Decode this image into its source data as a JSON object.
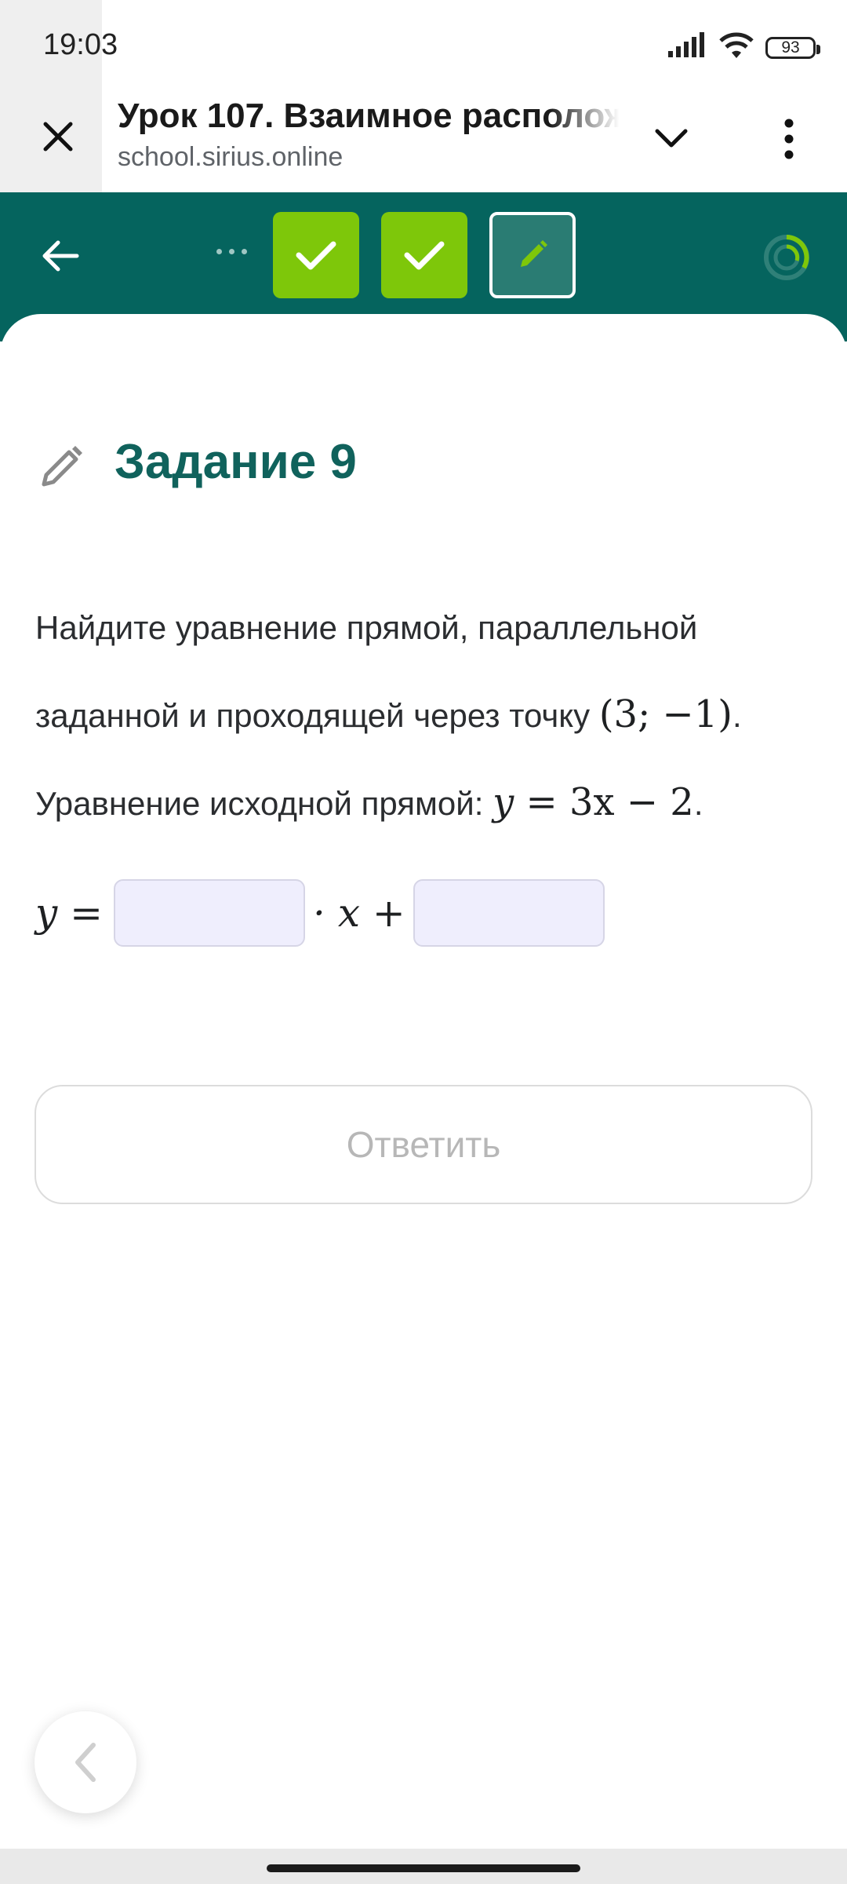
{
  "status_bar": {
    "time": "19:03",
    "battery": "93",
    "icons": [
      "signal-icon",
      "wifi-icon",
      "battery-icon"
    ]
  },
  "browser": {
    "title": "Урок 107. Взаимное располож",
    "url": "school.sirius.online",
    "icons": [
      "close-icon",
      "chevron-down-icon",
      "more-vert-icon"
    ]
  },
  "toolbar": {
    "background": "#05645e",
    "done_color": "#7ec70a",
    "tasks": [
      {
        "state": "done",
        "icon": "check-icon"
      },
      {
        "state": "done",
        "icon": "check-icon"
      },
      {
        "state": "current",
        "icon": "pencil-icon"
      }
    ]
  },
  "task": {
    "title": "Задание 9",
    "line1": "Найдите уравнение прямой, параллельной",
    "line2_text": "заданной и проходящей через точку",
    "line2_math": "(3; −1)",
    "line2_end": ".",
    "line3_text": "Уравнение исходной прямой:",
    "line3_math_lhs": "y",
    "line3_math_rhs": " = 3x − 2",
    "line3_end": "."
  },
  "answer": {
    "lhs": "y =",
    "mid": "· x +",
    "input1_value": "",
    "input2_value": ""
  },
  "submit_label": "Ответить"
}
